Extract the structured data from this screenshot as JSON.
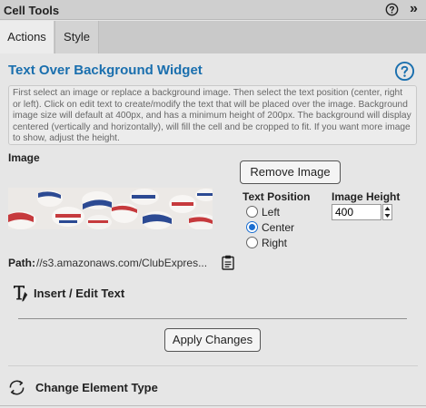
{
  "panel": {
    "title": "Cell Tools",
    "help_icon": "question-circle-icon",
    "collapse_icon": "double-chevron-right-icon",
    "collapse_glyph": "»"
  },
  "tabs": [
    {
      "label": "Actions",
      "active": true
    },
    {
      "label": "Style",
      "active": false
    }
  ],
  "widget": {
    "heading": "Text Over Background Widget",
    "help_icon": "question-circle-icon",
    "description": "First select an image or replace a background image. Then select the text position (center, right or left). Click on edit text to create/modify the text that will be placed over the image. Background image size will default at 400px, and has a minimum height of 200px. The background will display centered (vertically and horizontally), will fill the cell and be cropped to fit. If you want more image to show, adjust the height."
  },
  "image_section": {
    "label": "Image",
    "remove_button": "Remove Image",
    "text_position_label": "Text Position",
    "positions": [
      {
        "label": "Left",
        "selected": false
      },
      {
        "label": "Center",
        "selected": true
      },
      {
        "label": "Right",
        "selected": false
      }
    ],
    "image_height_label": "Image Height",
    "image_height_value": "400",
    "path_label": "Path:",
    "path_value": "//s3.amazonaws.com/ClubExpres...",
    "copy_icon": "clipboard-icon"
  },
  "insert_text": {
    "label": "Insert / Edit Text",
    "icon": "text-edit-icon"
  },
  "apply_button": "Apply Changes",
  "change_type": {
    "label": "Change Element Type",
    "icon": "refresh-cycle-icon"
  },
  "colors": {
    "accent": "#1a6fae",
    "radio_selected": "#1c6fd1",
    "panel_bg": "#e6e6e6"
  }
}
